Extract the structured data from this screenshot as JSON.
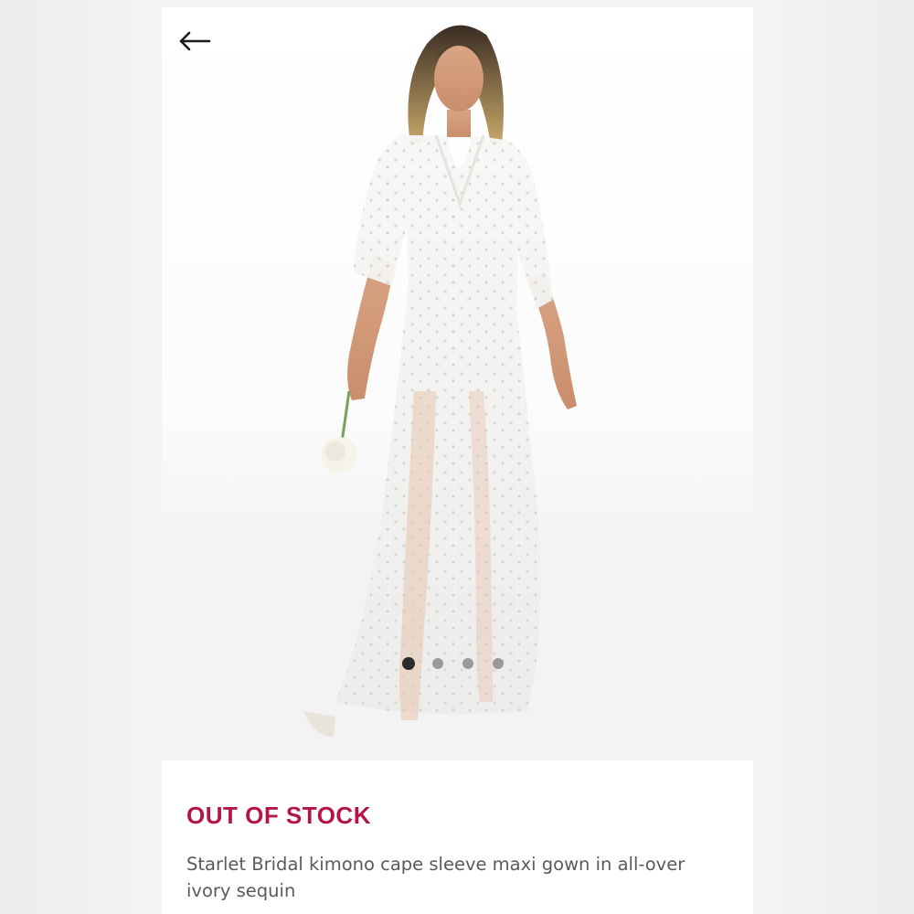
{
  "product": {
    "stock_status": "OUT OF STOCK",
    "title": "Starlet Bridal kimono cape sleeve maxi gown in all-over ivory sequin"
  },
  "navigation": {
    "back_icon": "arrow-left-icon"
  },
  "carousel": {
    "image_count": 4,
    "active_index": 0
  },
  "colors": {
    "stock_status": "#b5144b",
    "dot_active": "#2b2b2b",
    "dot_inactive": "#9a9a9a",
    "title_text": "#5a5a5a"
  }
}
